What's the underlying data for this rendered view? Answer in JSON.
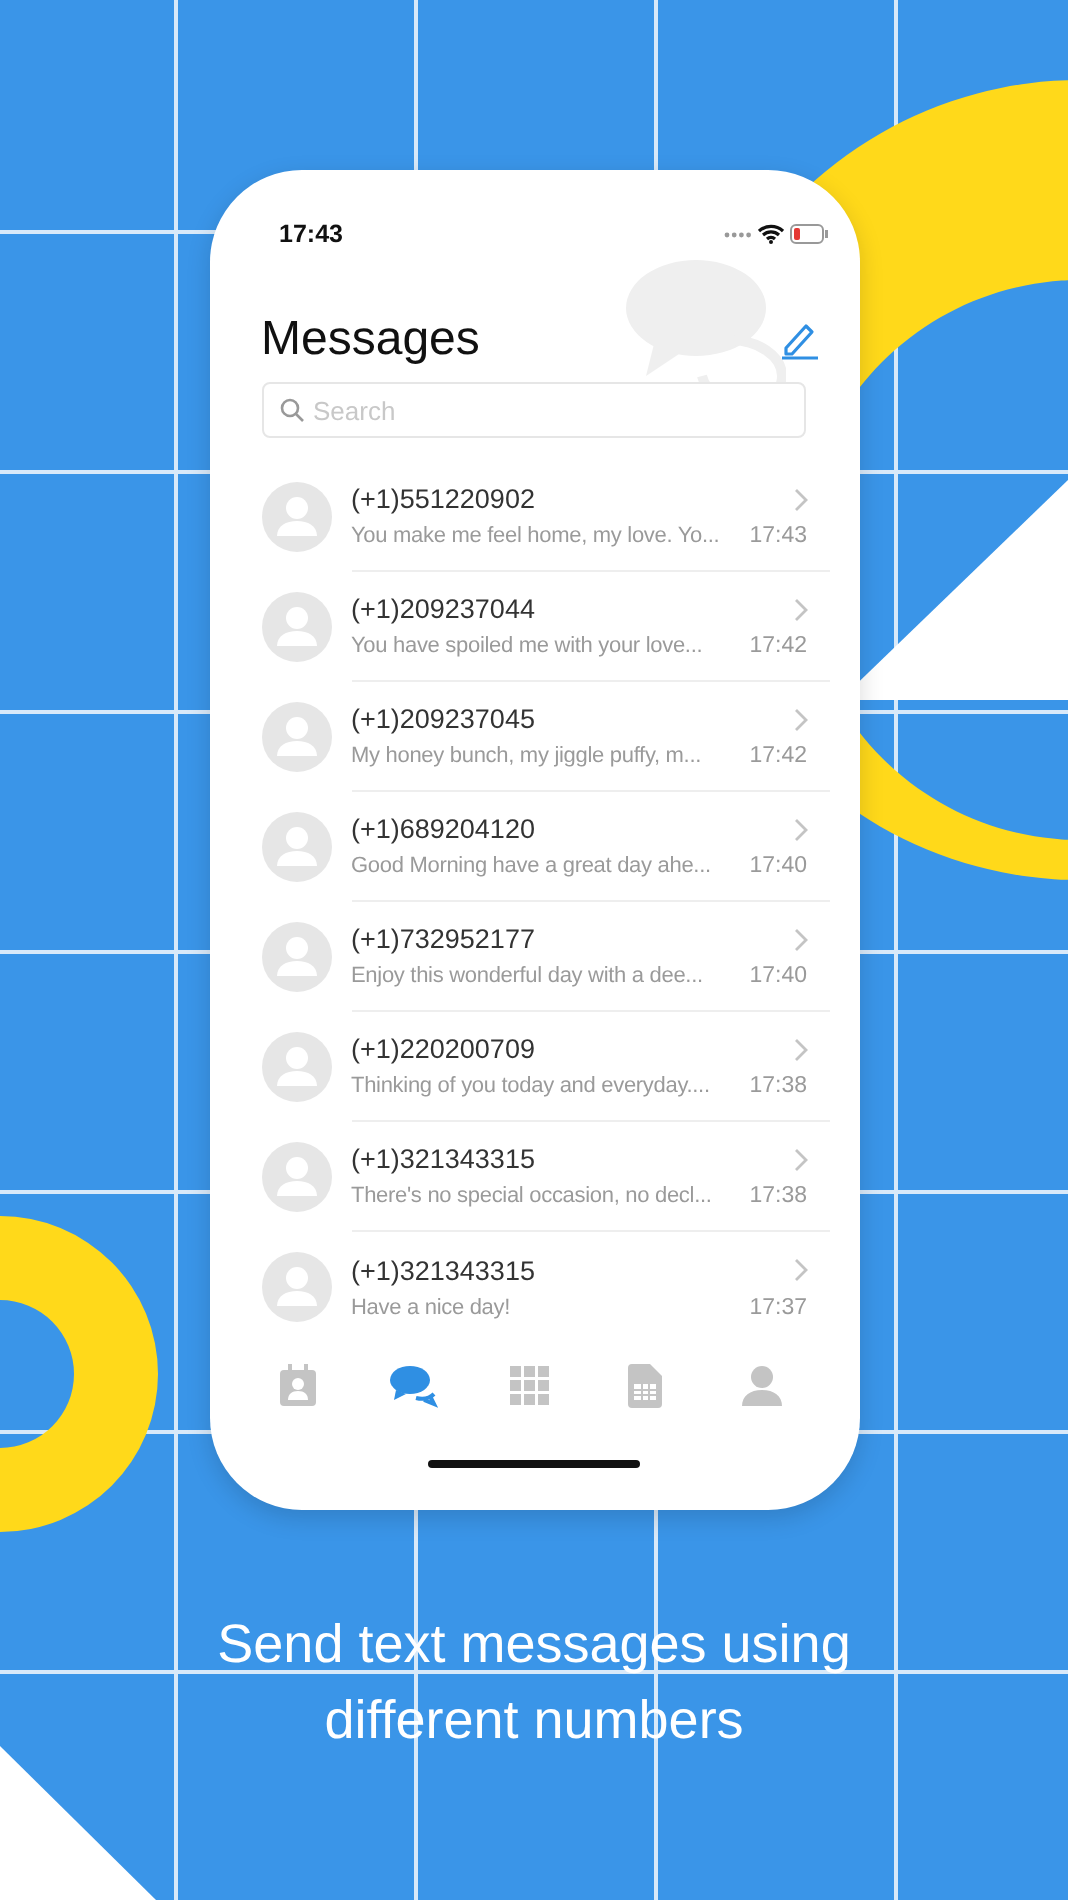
{
  "status_bar": {
    "time": "17:43"
  },
  "header": {
    "title": "Messages"
  },
  "search": {
    "placeholder": "Search"
  },
  "conversations": [
    {
      "number": "(+1)551220902",
      "preview": "You make me feel home, my love. Yo...",
      "time": "17:43"
    },
    {
      "number": "(+1)209237044",
      "preview": "You have spoiled me with your love...",
      "time": "17:42"
    },
    {
      "number": "(+1)209237045",
      "preview": "My honey bunch, my jiggle puffy, m...",
      "time": "17:42"
    },
    {
      "number": "(+1)689204120",
      "preview": "Good Morning have a great day ahe...",
      "time": "17:40"
    },
    {
      "number": "(+1)732952177",
      "preview": "Enjoy this wonderful day with a dee...",
      "time": "17:40"
    },
    {
      "number": "(+1)220200709",
      "preview": "Thinking of you today and everyday....",
      "time": "17:38"
    },
    {
      "number": "(+1)321343315",
      "preview": "There's no special occasion, no decl...",
      "time": "17:38"
    },
    {
      "number": "(+1)321343315",
      "preview": "Have a nice day!",
      "time": "17:37"
    }
  ],
  "tab_bar": [
    {
      "selected": false
    },
    {
      "selected": true
    },
    {
      "selected": false
    },
    {
      "selected": false
    },
    {
      "selected": false
    }
  ],
  "caption": "Send text messages using different numbers"
}
